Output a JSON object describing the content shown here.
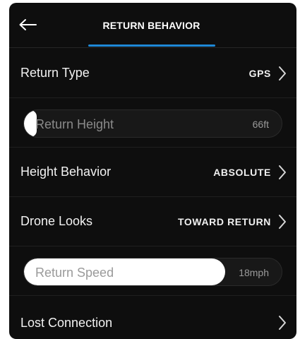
{
  "header": {
    "title": "RETURN BEHAVIOR",
    "back_icon": "back-arrow-icon",
    "accent_color": "#1e88d6"
  },
  "rows": {
    "return_type": {
      "label": "Return Type",
      "value": "GPS"
    },
    "height_behavior": {
      "label": "Height Behavior",
      "value": "ABSOLUTE"
    },
    "drone_looks": {
      "label": "Drone Looks",
      "value": "TOWARD RETURN"
    },
    "lost_connection": {
      "label": "Lost Connection",
      "value": ""
    }
  },
  "sliders": {
    "return_height": {
      "label": "Return Height",
      "value": "66ft",
      "fill_fraction": 0.05
    },
    "return_speed": {
      "label": "Return Speed",
      "value": "18mph",
      "fill_fraction": 0.78
    }
  }
}
